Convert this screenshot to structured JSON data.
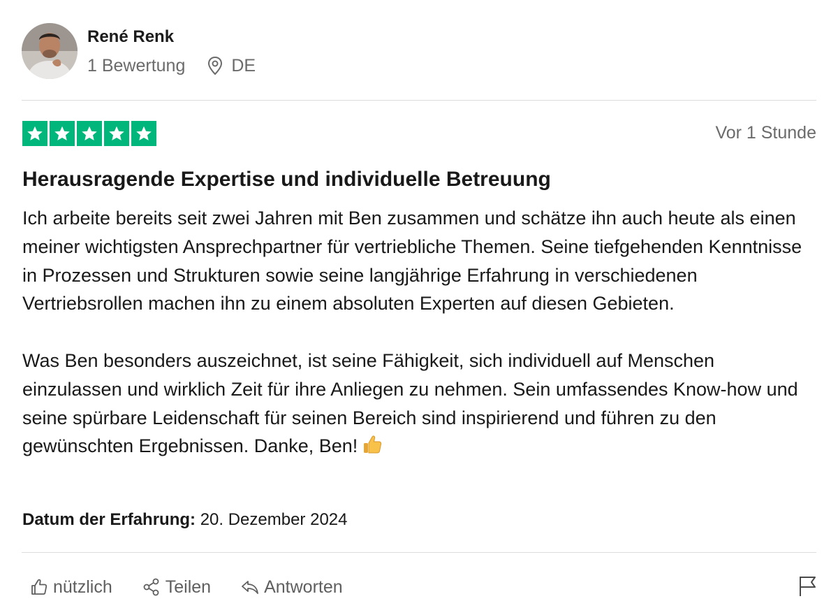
{
  "reviewer": {
    "name": "René Renk",
    "review_count": "1 Bewertung",
    "country": "DE"
  },
  "review": {
    "rating": 5,
    "rating_max": 5,
    "time_ago": "Vor 1 Stunde",
    "title": "Herausragende Expertise und individuelle Betreuung",
    "paragraph_1": "Ich arbeite bereits seit zwei Jahren mit Ben zusammen und schätze ihn auch heute als einen meiner wichtigsten Ansprechpartner für vertriebliche Themen. Seine tiefgehenden Kenntnisse in Prozessen und Strukturen sowie seine langjährige Erfahrung in verschiedenen Vertriebsrollen machen ihn zu einem absoluten Experten auf diesen Gebieten.",
    "paragraph_2": "Was Ben besonders auszeichnet, ist seine Fähigkeit, sich individuell auf Menschen einzulassen und wirklich Zeit für ihre Anliegen zu nehmen. Sein umfassendes Know-how und seine spürbare Leidenschaft für seinen Bereich sind inspirierend und führen zu den gewünschten Ergebnissen. Danke, Ben!",
    "experience_date_label": "Datum der Erfahrung:",
    "experience_date": "20. Dezember 2024"
  },
  "actions": {
    "useful": "nützlich",
    "share": "Teilen",
    "reply": "Antworten"
  },
  "icons": {
    "location": "map-pin-icon",
    "star": "star-icon",
    "useful": "thumbs-up-icon",
    "share": "share-icon",
    "reply": "reply-arrow-icon",
    "report": "flag-icon",
    "emoji": "thumbs-up-emoji"
  },
  "colors": {
    "star_green": "#00b67a",
    "text": "#191919",
    "muted": "#6b6b6b"
  }
}
